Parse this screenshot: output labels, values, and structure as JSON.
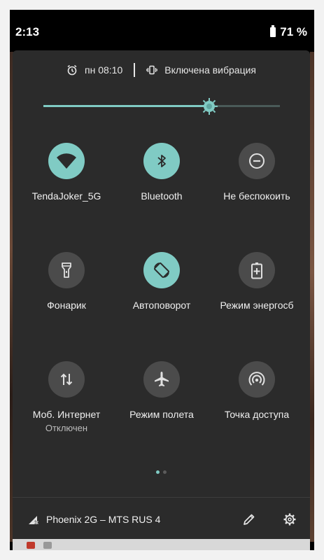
{
  "status_bar": {
    "time": "2:13",
    "battery": "71 %"
  },
  "header": {
    "alarm_time": "пн 08:10",
    "vibration_status": "Включена вибрация"
  },
  "brightness": {
    "level": 0.7
  },
  "tiles": [
    {
      "label": "TendaJoker_5G",
      "icon": "wifi-icon",
      "active": true,
      "sublabel": ""
    },
    {
      "label": "Bluetooth",
      "icon": "bluetooth-icon",
      "active": true,
      "sublabel": ""
    },
    {
      "label": "Не беспокоить",
      "icon": "do-not-disturb-icon",
      "active": false,
      "sublabel": ""
    },
    {
      "label": "Фонарик",
      "icon": "flashlight-icon",
      "active": false,
      "sublabel": ""
    },
    {
      "label": "Автоповорот",
      "icon": "auto-rotate-icon",
      "active": true,
      "sublabel": ""
    },
    {
      "label": "Режим энергосб",
      "icon": "battery-saver-icon",
      "active": false,
      "sublabel": ""
    },
    {
      "label": "Моб. Интернет",
      "icon": "mobile-data-icon",
      "active": false,
      "sublabel": "Отключен"
    },
    {
      "label": "Режим полета",
      "icon": "airplane-icon",
      "active": false,
      "sublabel": ""
    },
    {
      "label": "Точка доступа",
      "icon": "hotspot-icon",
      "active": false,
      "sublabel": ""
    }
  ],
  "pagination": {
    "pages": 2,
    "current": 1
  },
  "footer": {
    "network_label": "Phoenix 2G – MTS RUS 4"
  },
  "colors": {
    "accent": "#80cbc4",
    "panel": "#2b2b2b",
    "tile_inactive": "#4b4b4b"
  }
}
